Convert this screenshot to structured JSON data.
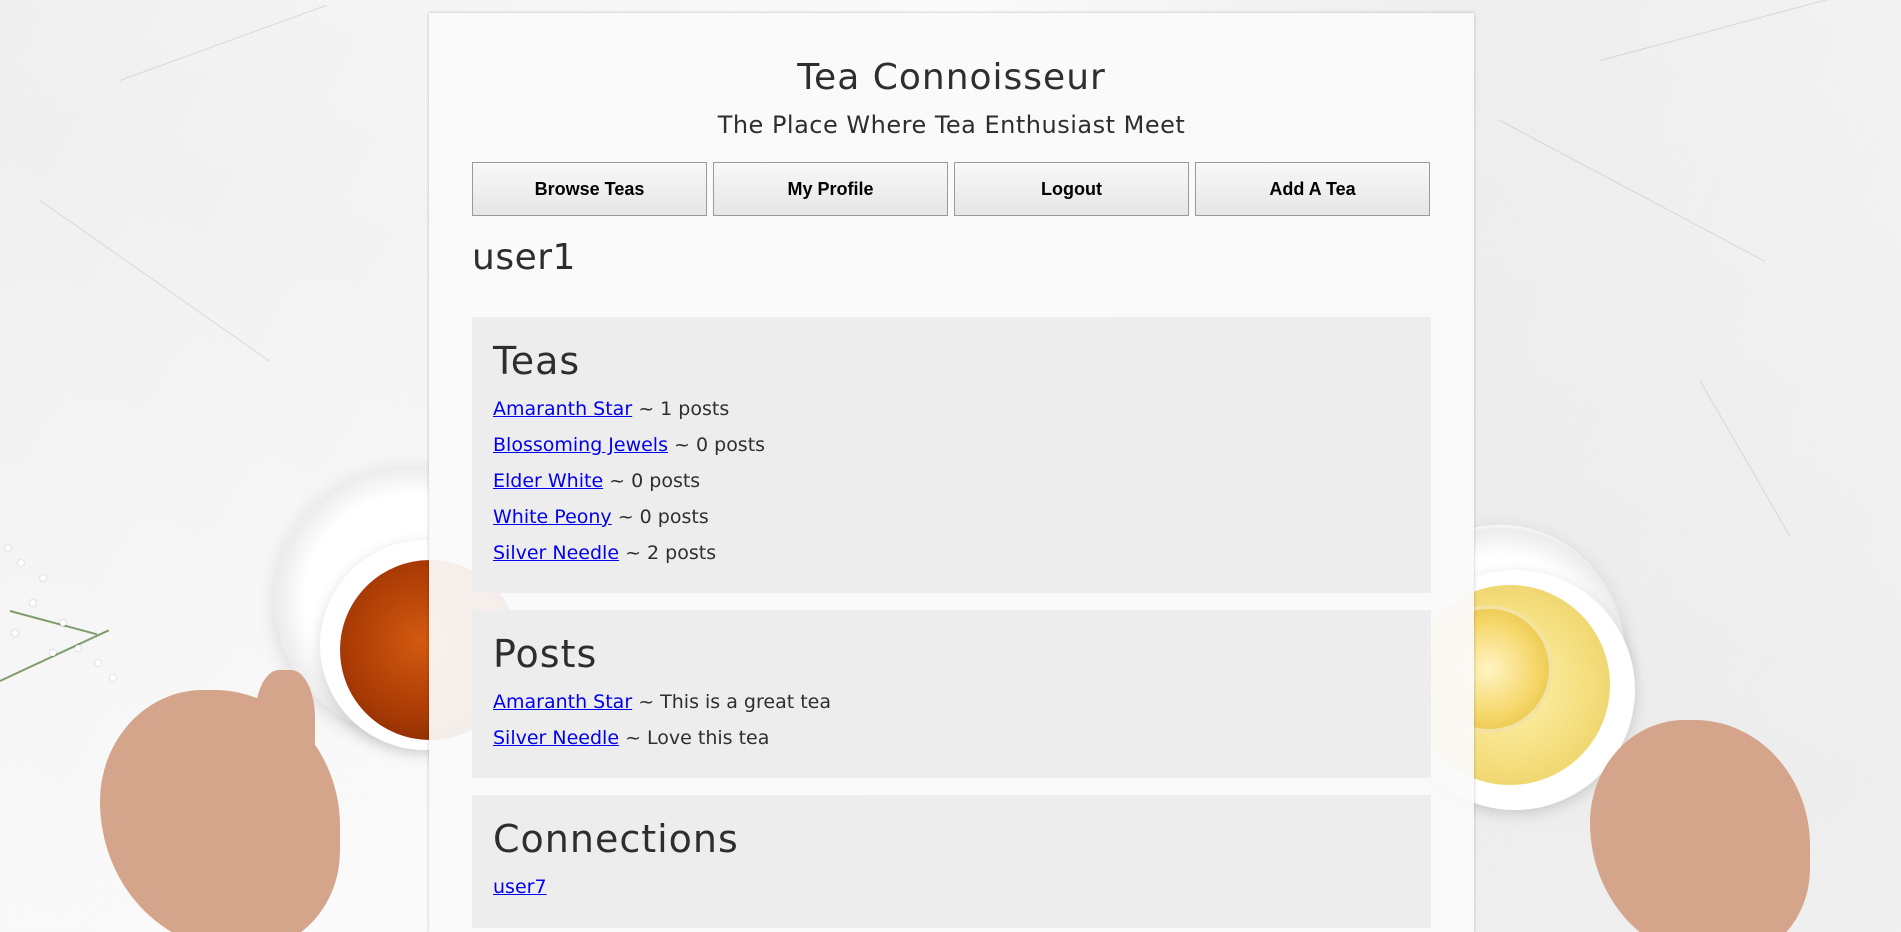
{
  "site": {
    "title": "Tea Connoisseur",
    "subtitle": "The Place Where Tea Enthusiast Meet"
  },
  "nav": {
    "browse_label": "Browse Teas",
    "profile_label": "My Profile",
    "logout_label": "Logout",
    "add_label": "Add A Tea"
  },
  "profile": {
    "username": "user1"
  },
  "teas": {
    "heading": "Teas",
    "items": [
      {
        "name": "Amaranth Star",
        "suffix": " ~ 1 posts"
      },
      {
        "name": "Blossoming Jewels",
        "suffix": " ~ 0 posts"
      },
      {
        "name": "Elder White",
        "suffix": " ~ 0 posts"
      },
      {
        "name": "White Peony",
        "suffix": " ~ 0 posts"
      },
      {
        "name": "Silver Needle",
        "suffix": " ~ 2 posts"
      }
    ]
  },
  "posts": {
    "heading": "Posts",
    "items": [
      {
        "tea": "Amaranth Star",
        "suffix": " ~ This is a great tea"
      },
      {
        "tea": "Silver Needle",
        "suffix": " ~ Love this tea"
      }
    ]
  },
  "connections": {
    "heading": "Connections",
    "items": [
      {
        "user": "user7"
      }
    ]
  },
  "colors": {
    "link": "#0000ee",
    "text": "#2e2e2e",
    "section_bg": "#ececec"
  }
}
